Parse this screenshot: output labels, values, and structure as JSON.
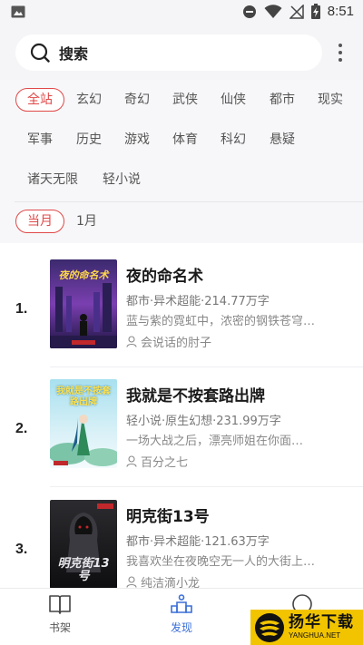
{
  "status_bar": {
    "time": "8:51"
  },
  "search": {
    "label": "搜索"
  },
  "category_chips": [
    {
      "label": "全站",
      "active": true
    },
    {
      "label": "玄幻"
    },
    {
      "label": "奇幻"
    },
    {
      "label": "武侠"
    },
    {
      "label": "仙侠"
    },
    {
      "label": "都市"
    },
    {
      "label": "现实"
    },
    {
      "label": "军事"
    },
    {
      "label": "历史"
    },
    {
      "label": "游戏"
    },
    {
      "label": "体育"
    },
    {
      "label": "科幻"
    },
    {
      "label": "悬疑"
    },
    {
      "label": "诸天无限"
    },
    {
      "label": "轻小说"
    }
  ],
  "period_chips": [
    {
      "label": "当月",
      "active": true
    },
    {
      "label": "1月"
    }
  ],
  "books": [
    {
      "rank": "1.",
      "title": "夜的命名术",
      "meta": "都市·异术超能·214.77万字",
      "desc": "蓝与紫的霓虹中，浓密的钢铁苍穹…",
      "author": "会说话的肘子",
      "cover_text": "夜的命名术"
    },
    {
      "rank": "2.",
      "title": "我就是不按套路出牌",
      "meta": "轻小说·原生幻想·231.99万字",
      "desc": "一场大战之后，漂亮师姐在你面…",
      "author": "百分之七",
      "cover_text": "我就是不按套路出牌"
    },
    {
      "rank": "3.",
      "title": "明克街13号",
      "meta": "都市·异术超能·121.63万字",
      "desc": "我喜欢坐在夜晚空无一人的大街上…",
      "author": "纯洁滴小龙",
      "cover_text": "明克街13号"
    }
  ],
  "bottom_nav": [
    {
      "label": "书架",
      "icon": "book-icon"
    },
    {
      "label": "发现",
      "icon": "discover-icon",
      "active": true
    },
    {
      "label": "",
      "icon": "profile-icon"
    }
  ],
  "watermark": {
    "text": "扬华下载",
    "url_text": "YANGHUA.NET"
  },
  "colors": {
    "accent_red": "#e04848",
    "accent_blue": "#3a6fd8",
    "watermark_yellow": "#f2c400"
  }
}
